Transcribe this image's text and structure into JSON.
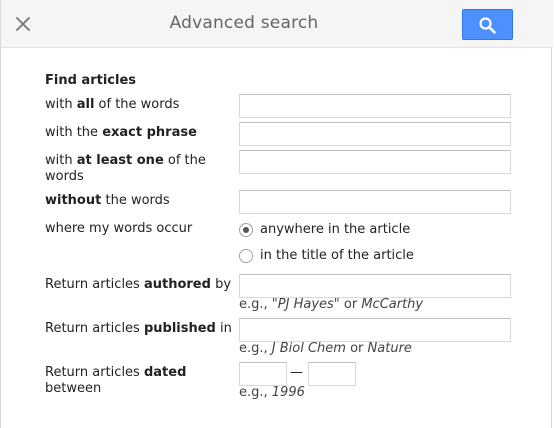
{
  "header": {
    "title": "Advanced search",
    "close_icon": "close-icon",
    "search_icon": "search-icon",
    "accent_color": "#4d90fe"
  },
  "find": {
    "section_title": "Find articles",
    "all_words": {
      "prefix": "with ",
      "bold": "all",
      "suffix": " of the words",
      "value": ""
    },
    "exact_phrase": {
      "prefix": "with the ",
      "bold": "exact phrase",
      "suffix": "",
      "value": ""
    },
    "at_least_one": {
      "prefix": "with ",
      "bold": "at least one",
      "suffix": " of the",
      "line2": "words",
      "value": ""
    },
    "without": {
      "prefix": "",
      "bold": "without",
      "suffix": " the words",
      "value": ""
    },
    "occur": {
      "label": "where my words occur",
      "options": [
        "anywhere in the article",
        "in the title of the article"
      ],
      "selected": "anywhere in the article"
    }
  },
  "authored": {
    "prefix": "Return articles ",
    "bold": "authored",
    "suffix": " by",
    "value": "",
    "hint_prefix": "e.g., \"",
    "hint_ex1": "PJ Hayes",
    "hint_mid": "\" or ",
    "hint_ex2": "McCarthy"
  },
  "published": {
    "prefix": "Return articles ",
    "bold": "published",
    "suffix": " in",
    "value": "",
    "hint_prefix": "e.g., ",
    "hint_ex1": "J Biol Chem",
    "hint_mid": " or ",
    "hint_ex2": "Nature"
  },
  "dated": {
    "prefix": "Return articles ",
    "bold": "dated",
    "line2": "between",
    "from_value": "",
    "to_value": "",
    "separator": "—",
    "hint_prefix": "e.g., ",
    "hint_ex": "1996"
  }
}
